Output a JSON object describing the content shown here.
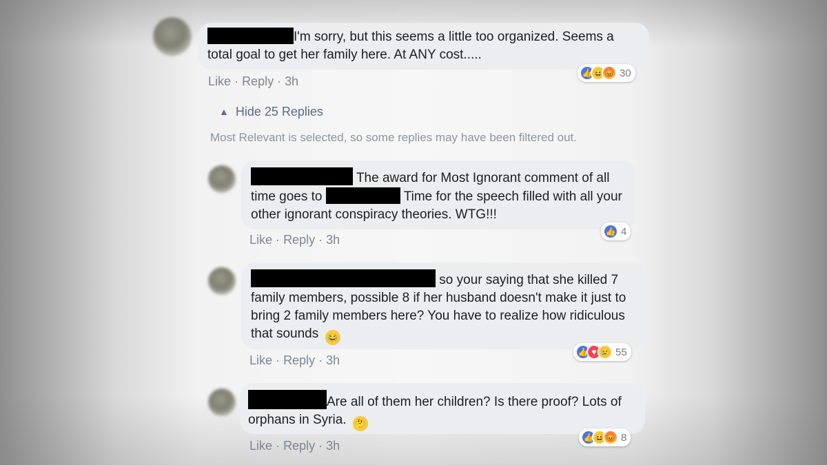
{
  "comments": [
    {
      "text": "I'm sorry, but this seems a little too organized. Seems a total goal to get her family here. At ANY cost.....",
      "reaction_icons": [
        "like-icon",
        "haha-icon",
        "angry-icon"
      ],
      "reaction_count": "30",
      "actions": {
        "like": "Like",
        "sep1": "·",
        "reply": "Reply",
        "sep2": "·",
        "time": "3h"
      }
    },
    {
      "text_part1": "The award for Most Ignorant comment of all time goes to",
      "text_part2": "Time for the speech filled with all your other ignorant conspiracy theories. WTG!!!",
      "reaction_icons": [
        "like-icon"
      ],
      "reaction_count": "4",
      "actions": {
        "like": "Like",
        "sep1": "·",
        "reply": "Reply",
        "sep2": "·",
        "time": "3h"
      }
    },
    {
      "text": "so your saying that she killed 7 family members, possible 8 if her husband doesn't make it just to bring 2 family members here? You have to realize how ridiculous that sounds",
      "inline_emoji": "laughing-crying-emoji",
      "reaction_icons": [
        "like-icon",
        "love-icon",
        "sad-icon"
      ],
      "reaction_count": "55",
      "actions": {
        "like": "Like",
        "sep1": "·",
        "reply": "Reply",
        "sep2": "·",
        "time": "3h"
      }
    },
    {
      "text": "Are all of them her children? Is there proof? Lots of orphans in Syria.",
      "inline_emoji": "thinking-emoji",
      "reaction_icons": [
        "like-icon",
        "haha-icon",
        "angry-icon"
      ],
      "reaction_count": "8",
      "actions": {
        "like": "Like",
        "sep1": "·",
        "reply": "Reply",
        "sep2": "·",
        "time": "3h"
      }
    }
  ],
  "hide_replies": {
    "label": "Hide 25 Replies",
    "icon": "chevron-up-icon"
  },
  "filter_note": "Most Relevant is selected, so some replies may have been filtered out.",
  "colors": {
    "bubble": "#ebedf0",
    "link": "#59698b",
    "meta": "#7d8593",
    "like_blue": "#4a74e6",
    "redaction": "#000000"
  }
}
